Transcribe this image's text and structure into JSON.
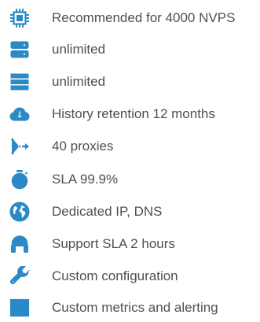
{
  "accent_color": "#2b8ac6",
  "text_color": "#4a5157",
  "features": [
    {
      "icon": "cpu-chip-icon",
      "text": "Recommended for 4000 NVPS"
    },
    {
      "icon": "server-icon",
      "text": "unlimited"
    },
    {
      "icon": "database-rows-icon",
      "text": "unlimited"
    },
    {
      "icon": "cloud-download-icon",
      "text": "History retention 12 months"
    },
    {
      "icon": "proxy-arrows-icon",
      "text": "40 proxies"
    },
    {
      "icon": "stopwatch-icon",
      "text": "SLA 99.9%"
    },
    {
      "icon": "globe-icon",
      "text": "Dedicated IP, DNS"
    },
    {
      "icon": "headphones-icon",
      "text": "Support SLA 2 hours"
    },
    {
      "icon": "wrench-icon",
      "text": "Custom configuration"
    },
    {
      "icon": "bar-chart-icon",
      "text": "Custom metrics and alerting"
    }
  ]
}
